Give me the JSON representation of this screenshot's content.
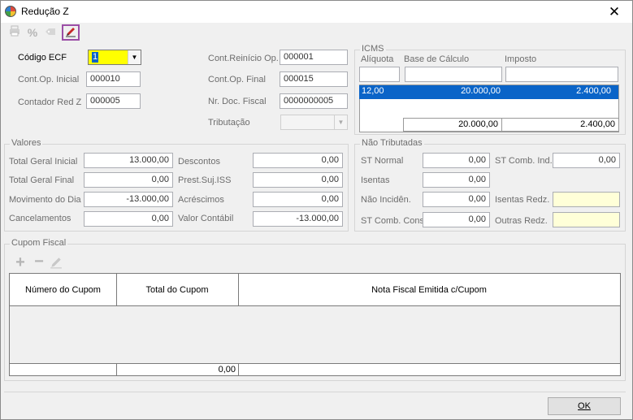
{
  "window": {
    "title": "Redução Z",
    "close_glyph": "✕"
  },
  "toolbar": {
    "print_icon": "printer-icon",
    "percent_label": "%",
    "tag_icon": "tag-icon",
    "edit_icon": "pencil-icon"
  },
  "header": {
    "codigo_ecf_label": "Código ECF",
    "codigo_ecf_value": "1",
    "cont_op_inicial_label": "Cont.Op. Inicial",
    "cont_op_inicial_value": "000010",
    "contador_red_z_label": "Contador Red Z",
    "contador_red_z_value": "000005",
    "cont_reinicio_label": "Cont.Reinício Op.",
    "cont_reinicio_value": "000001",
    "cont_op_final_label": "Cont.Op. Final",
    "cont_op_final_value": "000015",
    "nr_doc_fiscal_label": "Nr. Doc. Fiscal",
    "nr_doc_fiscal_value": "0000000005",
    "tributacao_label": "Tributação",
    "tributacao_value": ""
  },
  "icms": {
    "title": "ICMS",
    "col_aliquota": "Alíquota",
    "col_base": "Base de Cálculo",
    "col_imposto": "Imposto",
    "row": {
      "aliquota": "12,00",
      "base": "20.000,00",
      "imposto": "2.400,00"
    },
    "total_base": "20.000,00",
    "total_imposto": "2.400,00"
  },
  "valores": {
    "title": "Valores",
    "total_geral_inicial_label": "Total Geral Inicial",
    "total_geral_inicial": "13.000,00",
    "total_geral_final_label": "Total Geral Final",
    "total_geral_final": "0,00",
    "movimento_dia_label": "Movimento do Dia",
    "movimento_dia": "-13.000,00",
    "cancelamentos_label": "Cancelamentos",
    "cancelamentos": "0,00",
    "descontos_label": "Descontos",
    "descontos": "0,00",
    "prest_suj_iss_label": "Prest.Suj.ISS",
    "prest_suj_iss": "0,00",
    "acrescimos_label": "Acréscimos",
    "acrescimos": "0,00",
    "valor_contabil_label": "Valor Contábil",
    "valor_contabil": "-13.000,00"
  },
  "nao_tributadas": {
    "title": "Não Tributadas",
    "st_normal_label": "ST Normal",
    "st_normal": "0,00",
    "isentas_label": "Isentas",
    "isentas": "0,00",
    "nao_incidencia_label": "Não Incidên.",
    "nao_incidencia": "0,00",
    "st_comb_cons_label": "ST Comb. Cons",
    "st_comb_cons": "0,00",
    "st_comb_ind_label": "ST Comb. Ind.",
    "st_comb_ind": "0,00",
    "isentas_redz_label": "Isentas Redz.",
    "isentas_redz": "",
    "outras_redz_label": "Outras Redz.",
    "outras_redz": ""
  },
  "cupom": {
    "title": "Cupom Fiscal",
    "col_numero": "Número do Cupom",
    "col_total": "Total do Cupom",
    "col_nota": "Nota Fiscal Emitida c/Cupom",
    "footer_total": "0,00"
  },
  "footer": {
    "ok_label": "OK"
  }
}
